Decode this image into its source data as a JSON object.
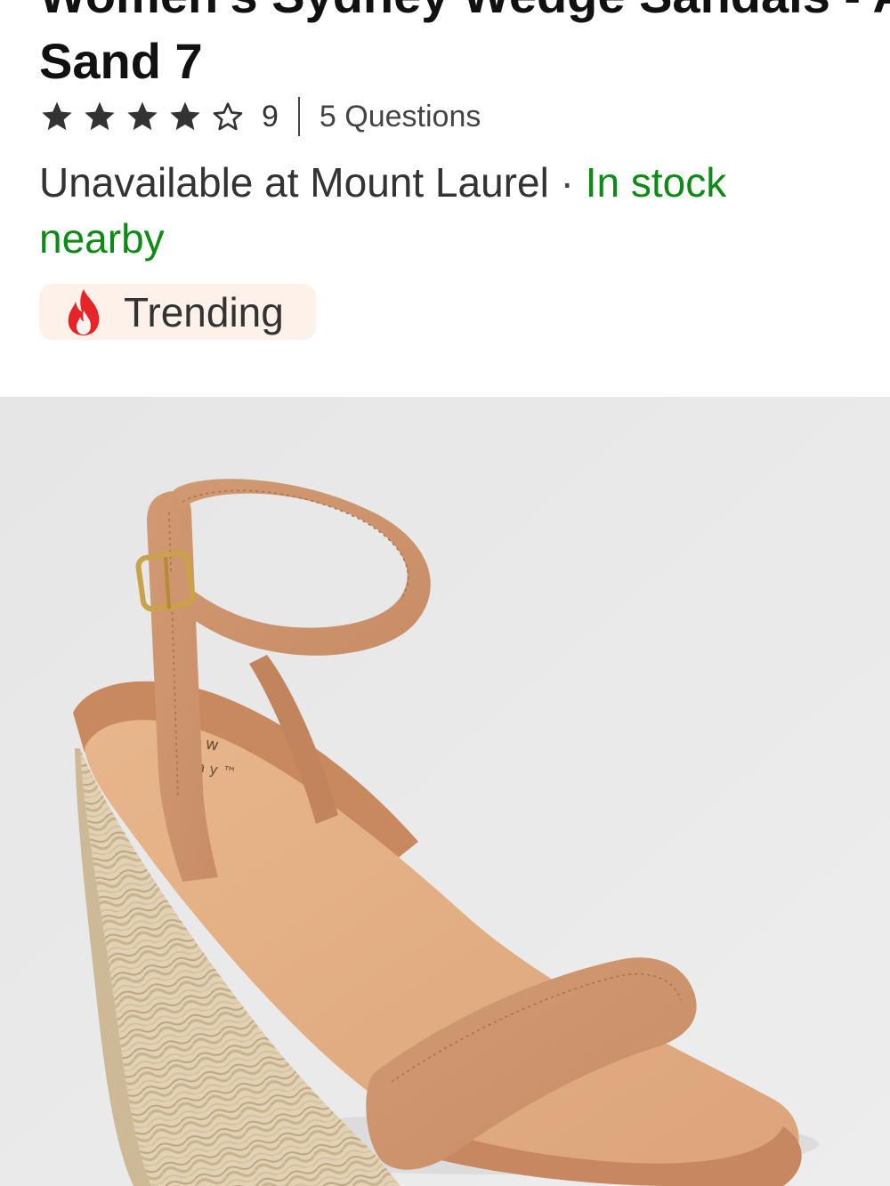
{
  "product": {
    "title_line1": "Women's Sydney Wedge Sandals - A New Day™",
    "title_line2": "Sand 7"
  },
  "rating": {
    "stars": 4,
    "max_stars": 5,
    "review_count": "9",
    "questions": "5 Questions"
  },
  "availability": {
    "store_text": "Unavailable at Mount Laurel",
    "separator": " · ",
    "stock_text": "In stock nearby",
    "stock_color": "#0e8a16"
  },
  "badge": {
    "icon": "fire-icon",
    "label": "Trending"
  },
  "image": {
    "brand_line1": "new",
    "brand_line2": "day™"
  }
}
